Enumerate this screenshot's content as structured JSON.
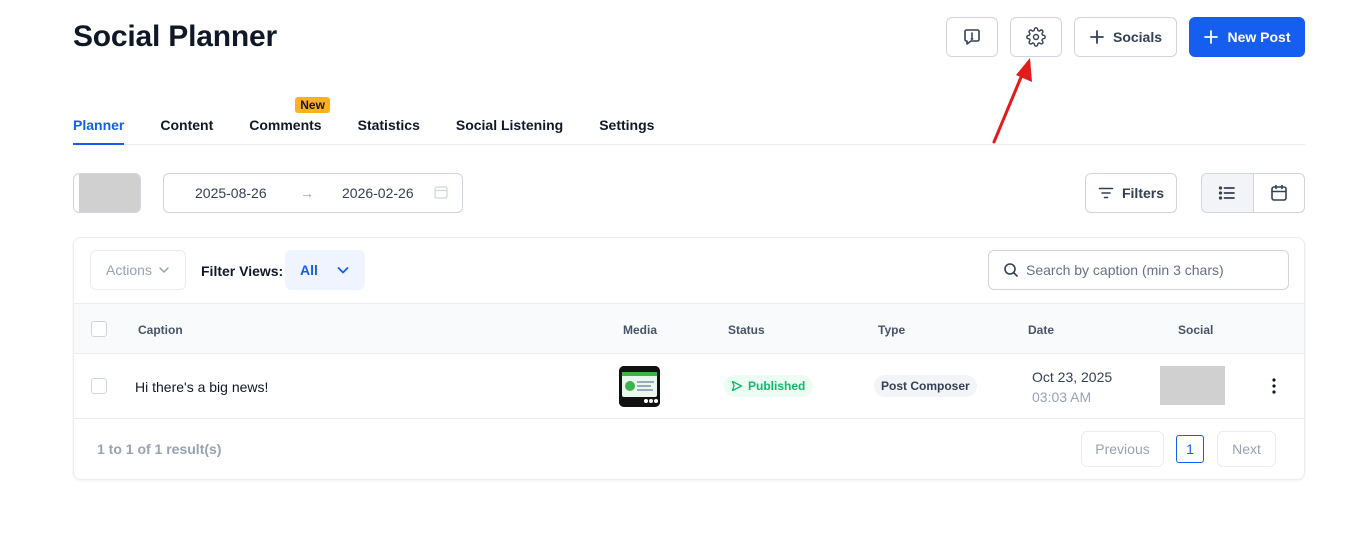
{
  "header": {
    "title": "Social Planner",
    "feedback_icon": "message-alert-icon",
    "settings_icon": "gear-icon",
    "socials_label": "Socials",
    "new_post_label": "New Post"
  },
  "tabs": [
    {
      "label": "Planner",
      "active": true
    },
    {
      "label": "Content"
    },
    {
      "label": "Comments",
      "badge": "New"
    },
    {
      "label": "Statistics"
    },
    {
      "label": "Social Listening"
    },
    {
      "label": "Settings"
    }
  ],
  "toolbar": {
    "date_start": "2025-08-26",
    "date_arrow": "→",
    "date_end": "2026-02-26",
    "filters_label": "Filters"
  },
  "table_controls": {
    "actions_label": "Actions",
    "filter_views_label": "Filter Views:",
    "filter_views_value": "All",
    "search_placeholder": "Search by caption (min 3 chars)"
  },
  "table": {
    "columns": [
      "Caption",
      "Media",
      "Status",
      "Type",
      "Date",
      "Social"
    ],
    "rows": [
      {
        "caption": "Hi there's a big news!",
        "status": "Published",
        "type": "Post Composer",
        "date": "Oct 23, 2025",
        "time": "03:03 AM"
      }
    ]
  },
  "pagination": {
    "summary": "1 to 1 of 1 result(s)",
    "previous": "Previous",
    "current_page": "1",
    "next": "Next"
  },
  "colors": {
    "accent": "#155eef",
    "badge": "#fdb022",
    "success": "#12b76a",
    "annotation_arrow": "#e31b1b"
  }
}
